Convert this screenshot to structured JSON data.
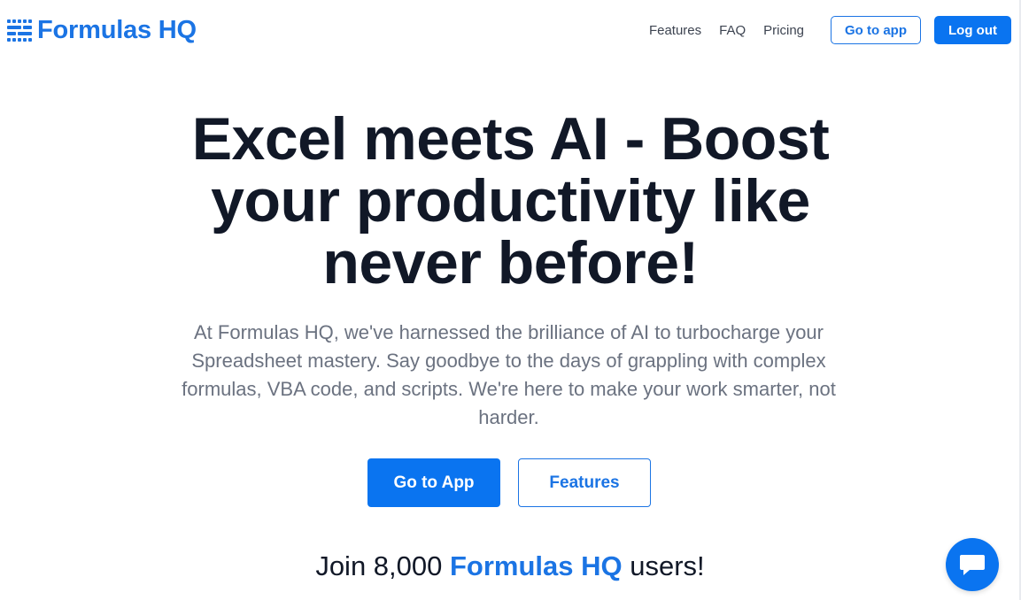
{
  "header": {
    "logo_text": "Formulas HQ",
    "nav": {
      "features": "Features",
      "faq": "FAQ",
      "pricing": "Pricing"
    },
    "go_to_app_label": "Go to app",
    "logout_label": "Log out"
  },
  "hero": {
    "title": "Excel meets AI - Boost your productivity like never before!",
    "subtitle": "At Formulas HQ, we've harnessed the brilliance of AI to turbocharge your Spreadsheet mastery. Say goodbye to the days of grappling with complex formulas, VBA code, and scripts. We're here to make your work smarter, not harder.",
    "primary_cta": "Go to App",
    "secondary_cta": "Features"
  },
  "social_proof": {
    "prefix": "Join 8,000 ",
    "brand": "Formulas HQ",
    "suffix": " users!"
  },
  "icons": {
    "logo": "formulas-hq-logo-icon",
    "chat": "chat-bubble-icon"
  },
  "colors": {
    "brand_blue": "#1b74e4",
    "button_blue": "#0a74f0",
    "heading": "#111827",
    "body_text": "#6b7280",
    "nav_text": "#3d4451"
  }
}
